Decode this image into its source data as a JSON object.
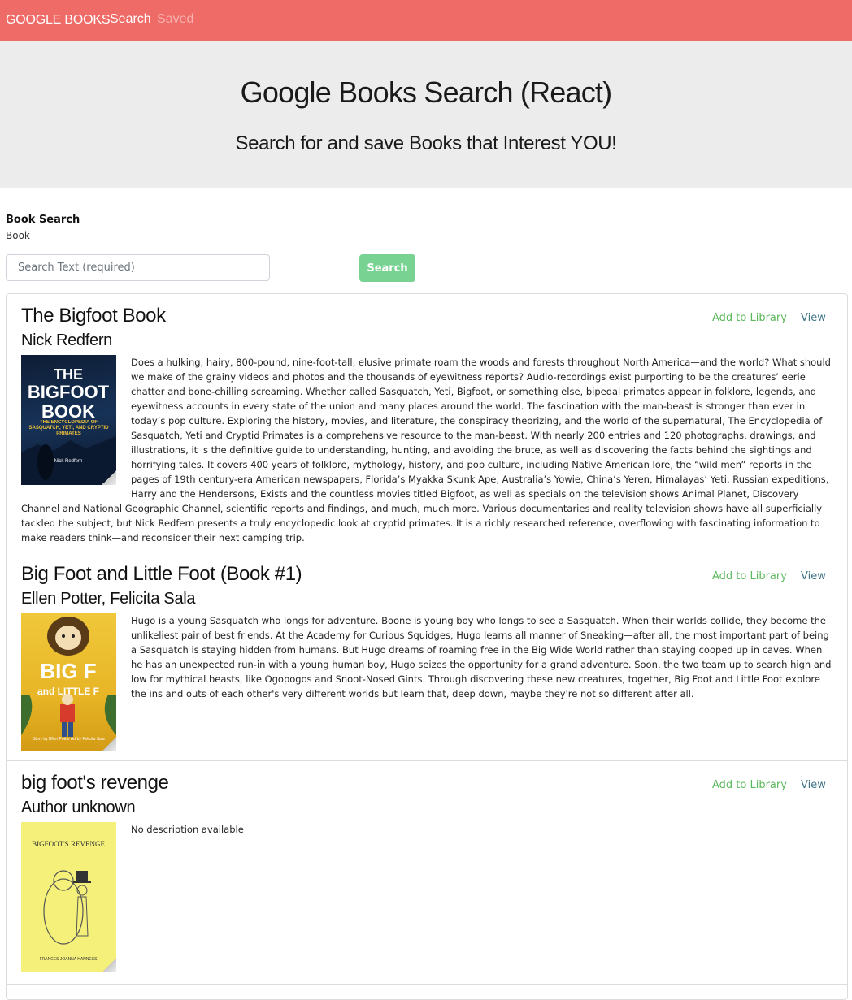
{
  "navbar": {
    "brand": "GOOGLE BOOKS",
    "links": [
      "Search",
      "Saved"
    ]
  },
  "jumbotron": {
    "title": "Google Books Search (React)",
    "subtitle": "Search for and save Books that Interest YOU!"
  },
  "search_form": {
    "heading": "Book Search",
    "label": "Book",
    "placeholder": "Search Text (required)",
    "button_label": "Search"
  },
  "actions": {
    "add_label": "Add to Library",
    "view_label": "View"
  },
  "books": [
    {
      "title": "The Bigfoot Book",
      "author": "Nick Redfern",
      "cover": {
        "line1": "THE",
        "line2": "BIGFOOT",
        "line3": "BOOK",
        "tagline": "THE ENCYCLOPEDIA OF SASQUATCH, YETI, AND CRYPTID PRIMATES",
        "byline": "Nick Redfern"
      },
      "description": "Does a hulking, hairy, 800-pound, nine-foot-tall, elusive primate roam the woods and forests throughout North America—and the world? What should we make of the grainy videos and photos and the thousands of eyewitness reports? Audio-recordings exist purporting to be the creatures’ eerie chatter and bone-chilling screaming. Whether called Sasquatch, Yeti, Bigfoot, or something else, bipedal primates appear in folklore, legends, and eyewitness accounts in every state of the union and many places around the world. The fascination with the man-beast is stronger than ever in today’s pop culture. Exploring the history, movies, and literature, the conspiracy theorizing, and the world of the supernatural, The Encyclopedia of Sasquatch, Yeti and Cryptid Primates is a comprehensive resource to the man-beast. With nearly 200 entries and 120 photographs, drawings, and illustrations, it is the definitive guide to understanding, hunting, and avoiding the brute, as well as discovering the facts behind the sightings and horrifying tales. It covers 400 years of folklore, mythology, history, and pop culture, including Native American lore, the “wild men” reports in the pages of 19th century-era American newspapers, Florida’s Myakka Skunk Ape, Australia’s Yowie, China’s Yeren, Himalayas’ Yeti, Russian expeditions, Harry and the Hendersons, Exists and the countless movies titled Bigfoot, as well as specials on the television shows Animal Planet, Discovery Channel and National Geographic Channel, scientific reports and findings, and much, much more. Various documentaries and reality television shows have all superficially tackled the subject, but Nick Redfern presents a truly encyclopedic look at cryptid primates. It is a richly researched reference, overflowing with fascinating information to make readers think—and reconsider their next camping trip."
    },
    {
      "title": "Big Foot and Little Foot (Book #1)",
      "author": "Ellen Potter, Felicita Sala",
      "cover": {
        "line1": "BIG F",
        "line2": "and LITTLE F",
        "byline": "Story by Ellen Potter  Art by Felicita Sala"
      },
      "description": "Hugo is a young Sasquatch who longs for adventure. Boone is young boy who longs to see a Sasquatch. When their worlds collide, they become the unlikeliest pair of best friends. At the Academy for Curious Squidges, Hugo learns all manner of Sneaking—after all, the most important part of being a Sasquatch is staying hidden from humans. But Hugo dreams of roaming free in the Big Wide World rather than staying cooped up in caves. When he has an unexpected run-in with a young human boy, Hugo seizes the opportunity for a grand adventure. Soon, the two team up to search high and low for mythical beasts, like Ogopogos and Snoot-Nosed Gints. Through discovering these new creatures, together, Big Foot and Little Foot explore the ins and outs of each other's very different worlds but learn that, deep down, maybe they're not so different after all."
    },
    {
      "title": "big foot's revenge",
      "author": "Author unknown",
      "cover": {
        "line1": "BIGFOOT'S REVENGE",
        "byline": "FRANCES JOANNA HANNESS"
      },
      "description": "No description available"
    }
  ],
  "colors": {
    "navbar": "#ef6b67",
    "jumbotron": "#ececec",
    "search_button": "#78d292",
    "add_link": "#5cb85c",
    "view_link": "#3f7488"
  }
}
